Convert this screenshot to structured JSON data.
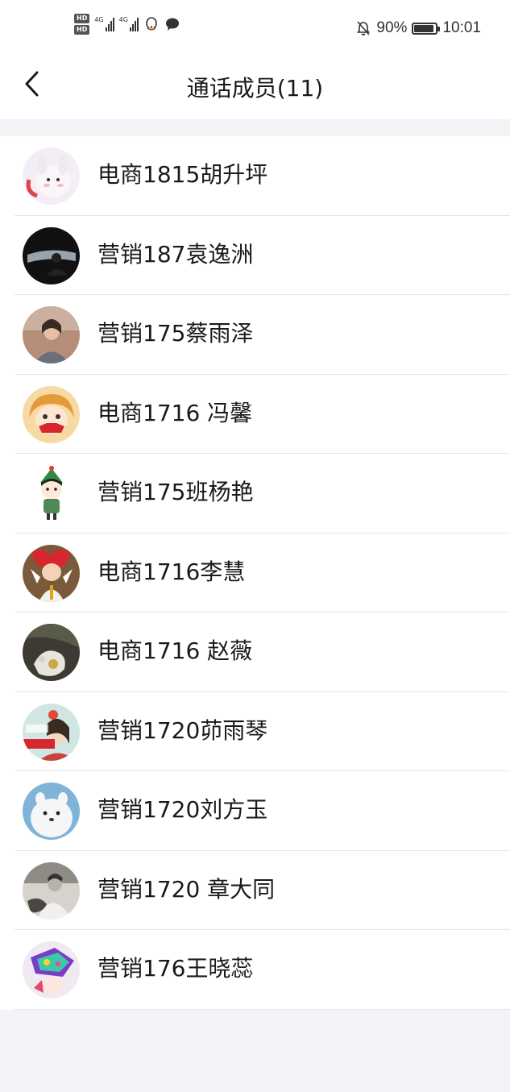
{
  "status_bar": {
    "battery_percent": "90%",
    "time": "10:01",
    "hd1": "HD",
    "hd2": "HD",
    "net1": "4G",
    "net2": "4G",
    "icons": [
      "hd-icon",
      "signal-icon",
      "signal-icon",
      "qq-icon",
      "chat-bubble-icon",
      "mute-bell-icon",
      "battery-icon"
    ]
  },
  "header": {
    "title": "通话成员(11)",
    "back_icon": "chevron-left-icon"
  },
  "members": [
    {
      "name": "电商1815胡升坪",
      "avatar": "avatar-bunny"
    },
    {
      "name": "营销187袁逸洲",
      "avatar": "avatar-dark-window"
    },
    {
      "name": "营销175蔡雨泽",
      "avatar": "avatar-woman-portrait"
    },
    {
      "name": "电商1716 冯馨",
      "avatar": "avatar-cartoon-girl"
    },
    {
      "name": "营销175班杨艳",
      "avatar": "avatar-cartoon-boy"
    },
    {
      "name": "电商1716李慧",
      "avatar": "avatar-baby"
    },
    {
      "name": "电商1716 赵薇",
      "avatar": "avatar-flowers"
    },
    {
      "name": "营销1720茆雨琴",
      "avatar": "avatar-poster"
    },
    {
      "name": "营销1720刘方玉",
      "avatar": "avatar-white-dog"
    },
    {
      "name": "营销1720 章大同",
      "avatar": "avatar-bw-man"
    },
    {
      "name": "营销176王晓蕊",
      "avatar": "avatar-colorful-girl"
    }
  ],
  "colors": {
    "background": "#f2f4f7",
    "surface": "#ffffff",
    "divider": "#e6e6e6",
    "text": "#1a1a1a"
  }
}
